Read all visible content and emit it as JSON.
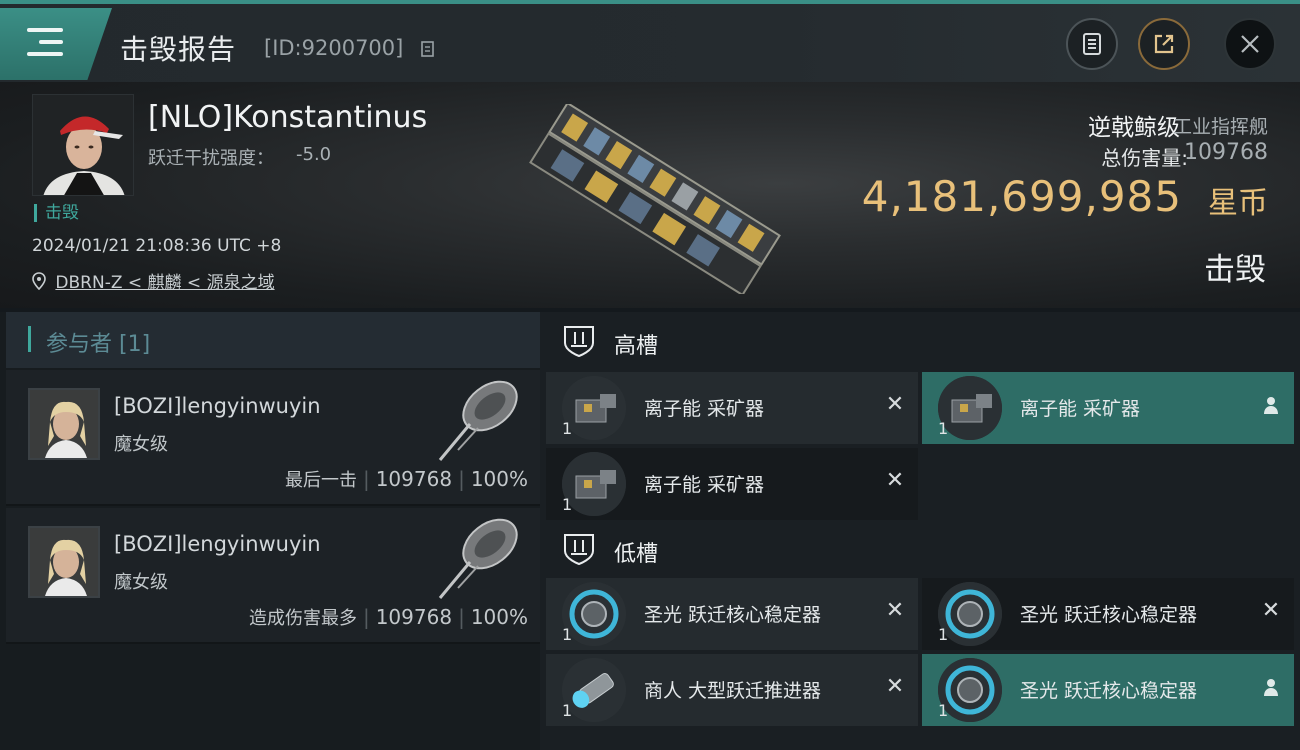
{
  "header": {
    "title": "击毁报告",
    "report_id": "[ID:9200700]",
    "buttons": [
      "clipboard-icon",
      "share-icon",
      "close-icon"
    ]
  },
  "victim": {
    "name": "[NLO]Konstantinus",
    "warp_scramble_label": "跃迁干扰强度：",
    "warp_scramble_value": "-5.0",
    "status": "击毁",
    "timestamp": "2024/01/21 21:08:36 UTC +8",
    "location": "DBRN-Z < 麒麟 < 源泉之域",
    "ship_class": "逆戟鲸级",
    "ship_type": "工业指挥舰",
    "damage_label": "总伤害量:",
    "damage_value": "109768",
    "isk_value": "4,181,699,985",
    "isk_unit": "星币",
    "result": "击毁"
  },
  "participants": {
    "title": "参与者 [1]",
    "rows": [
      {
        "name": "[BOZI]lengyinwuyin",
        "ship": "魔女级",
        "label": "最后一击",
        "damage": "109768",
        "percent": "100%"
      },
      {
        "name": "[BOZI]lengyinwuyin",
        "ship": "魔女级",
        "label": "造成伤害最多",
        "damage": "109768",
        "percent": "100%"
      }
    ]
  },
  "fitting": {
    "high_slot_title": "高槽",
    "low_slot_title": "低槽",
    "high_modules": [
      {
        "name": "离子能 采矿器",
        "qty": "1",
        "state": "destroyed"
      },
      {
        "name": "离子能 采矿器",
        "qty": "1",
        "state": "dropped"
      },
      {
        "name": "离子能 采矿器",
        "qty": "1",
        "state": "destroyed"
      }
    ],
    "low_modules": [
      {
        "name": "圣光 跃迁核心稳定器",
        "qty": "1",
        "state": "destroyed"
      },
      {
        "name": "圣光 跃迁核心稳定器",
        "qty": "1",
        "state": "destroyed"
      },
      {
        "name": "商人 大型跃迁推进器",
        "qty": "1",
        "state": "destroyed"
      },
      {
        "name": "圣光 跃迁核心稳定器",
        "qty": "1",
        "state": "dropped"
      }
    ]
  },
  "colors": {
    "accent": "#3fa89d",
    "isk": "#e8c07a",
    "dropped_bg": "#2e6d66"
  }
}
